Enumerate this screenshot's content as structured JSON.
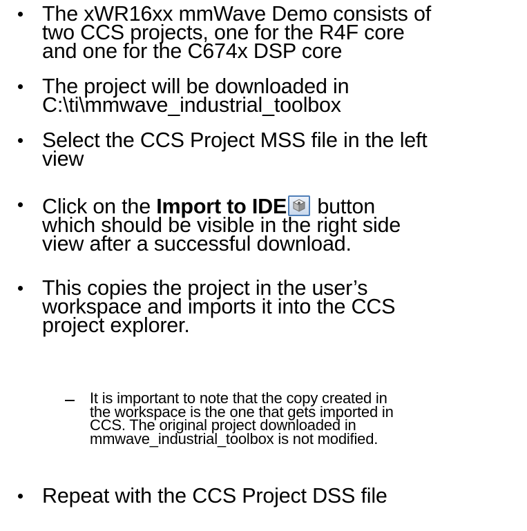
{
  "bullets": [
    {
      "lines": [
        "The xWR16xx mmWave Demo consists of",
        "two CCS projects, one for the R4F core",
        "and one for the C674x DSP core"
      ]
    },
    {
      "lines": [
        "The project will be downloaded in",
        "C:\\ti\\mmwave_industrial_toolbox"
      ]
    },
    {
      "lines": [
        "Select the CCS Project MSS file in the left",
        "view"
      ]
    },
    {
      "line1_prefix": "Click on the ",
      "line1_bold": "Import to IDE",
      "line1_suffix": " button",
      "button_icon": "import-to-ide-icon",
      "lines": [
        "which should be visible in the right side",
        "view after a successful download."
      ]
    },
    {
      "lines": [
        "This copies the project in the user’s",
        "workspace and imports it into the CCS",
        "project explorer."
      ]
    },
    {
      "lines": [
        "Repeat with the CCS Project DSS file"
      ]
    }
  ],
  "sub_bullet": {
    "lines": [
      "It is important to note that the copy created in",
      "the workspace is the one that gets imported in",
      "CCS. The original project downloaded in",
      "mmwave_industrial_toolbox is not modified."
    ]
  },
  "colors": {
    "text": "#000000",
    "button_border": "#4f7fb8"
  }
}
